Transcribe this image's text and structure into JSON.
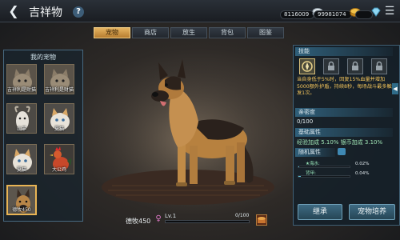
{
  "header": {
    "title": "吉祥物",
    "back_icon": "back-arrow-icon",
    "help_label": "?",
    "currencies": [
      {
        "amount": "8116009",
        "icon": "silver-coin-icon",
        "add": "+"
      },
      {
        "amount": "99981074",
        "icon": "gold-coin-icon",
        "add": "+"
      },
      {
        "amount": "",
        "icon": "diamond-icon",
        "add": "+"
      }
    ],
    "menu_icon": "menu-icon"
  },
  "tabs": [
    {
      "label": "宠物",
      "active": true
    },
    {
      "label": "商店",
      "active": false
    },
    {
      "label": "放生",
      "active": false
    },
    {
      "label": "背包",
      "active": false
    },
    {
      "label": "图鉴",
      "active": false
    }
  ],
  "pets_panel": {
    "title": "我的宠物",
    "pets": [
      {
        "label": "吉祥利是财猫",
        "kind": "cat"
      },
      {
        "label": "吉祥利是财猫",
        "kind": "cat"
      },
      {
        "label": "山羊",
        "kind": "goat"
      },
      {
        "label": "夏猫",
        "kind": "cat-white"
      },
      {
        "label": "夏猫",
        "kind": "cat-white"
      },
      {
        "label": "大公鸡",
        "kind": "rooster"
      },
      {
        "label": "德牧450",
        "kind": "dog",
        "selected": true
      }
    ]
  },
  "stage": {
    "pet_name": "德牧450",
    "gender_icon": "female-symbol-icon",
    "level_label": "Lv.1",
    "exp_text": "0/100",
    "exp_fraction": 0.0,
    "food_icon": "pet-food-icon"
  },
  "right_panel": {
    "skills_title": "技能",
    "skill_desc": "当自身低于5%时，回复15%血量并增加5000额外护盾，持续8秒，每场战斗最多触发1次。",
    "intimacy_title": "亲密度",
    "intimacy_value": "0/100",
    "base_attr_title": "基础属性",
    "base_attr_value": "经验加成 5.10%  银币加成 3.10%",
    "random_attr_title": "随机属性",
    "random_attrs": [
      {
        "name": "★海水:",
        "pct": "0.02%",
        "fraction": 0.02
      },
      {
        "name": "背甲:",
        "pct": "0.04%",
        "fraction": 0.04
      }
    ],
    "inherit_button": "继承",
    "train_button": "宠物培养"
  }
}
